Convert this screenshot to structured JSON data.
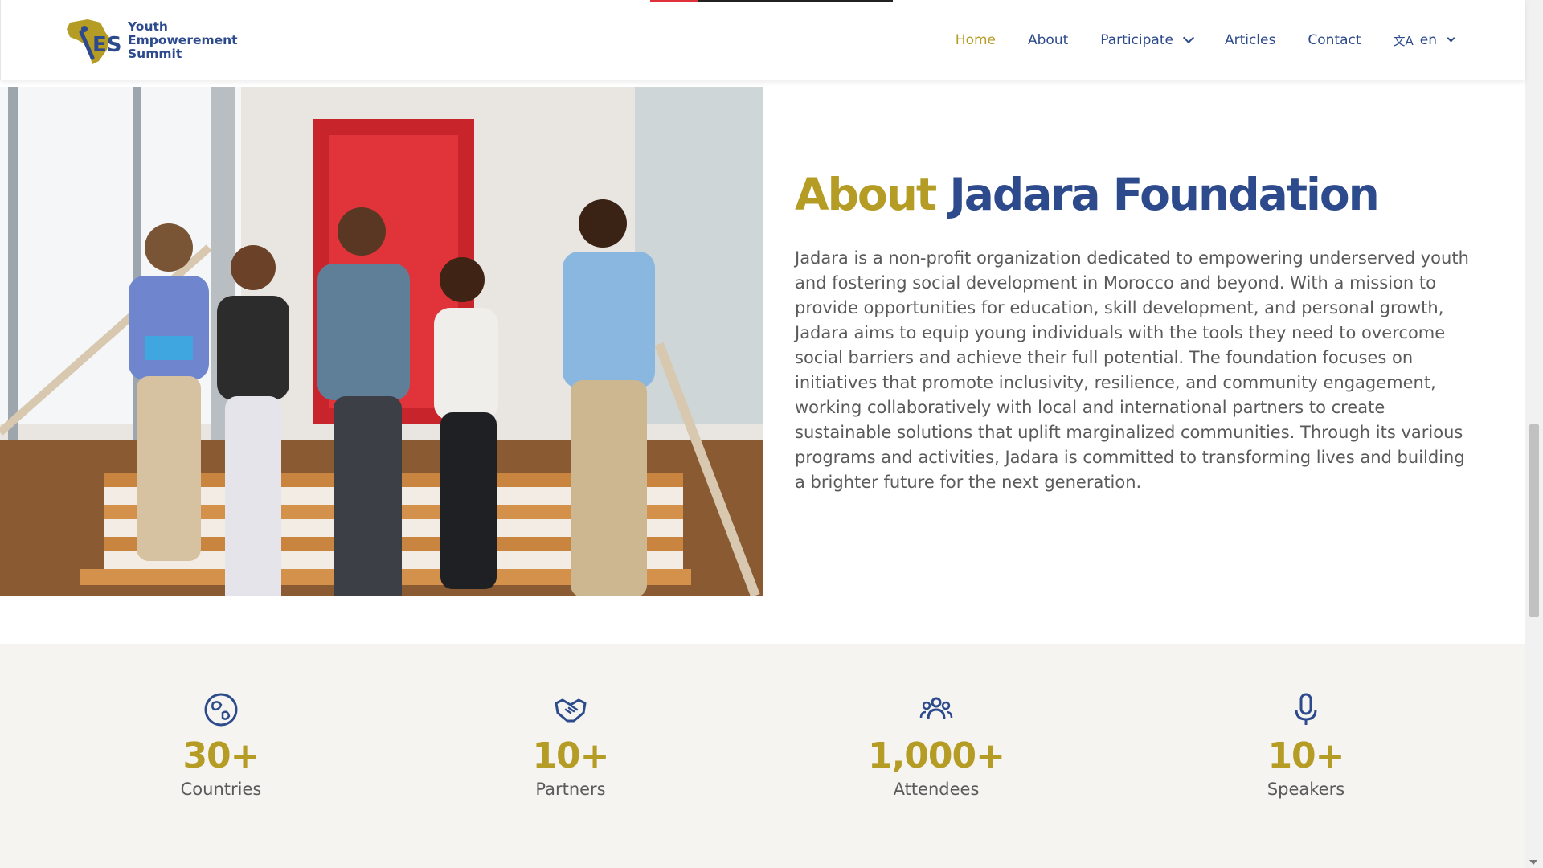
{
  "header": {
    "logo_lines": [
      "Youth",
      "Empowerement",
      "Summit"
    ],
    "logo_mark": "YES",
    "nav": [
      {
        "label": "Home",
        "active": true
      },
      {
        "label": "About"
      },
      {
        "label": "Participate",
        "dropdown": true
      },
      {
        "label": "Articles"
      },
      {
        "label": "Contact"
      }
    ],
    "language": {
      "icon": "translate-icon",
      "value": "en"
    }
  },
  "about": {
    "title_first": "About",
    "title_second": "Jadara Foundation",
    "body": "Jadara is a non-profit organization dedicated to empowering underserved youth and fostering social development in Morocco and beyond. With a mission to provide opportunities for education, skill development, and personal growth, Jadara aims to equip young individuals with the tools they need to overcome social barriers and achieve their full potential. The foundation focuses on initiatives that promote inclusivity, resilience, and community engagement, working collaboratively with local and international partners to create sustainable solutions that uplift marginalized communities. Through its various programs and activities, Jadara is committed to transforming lives and building a brighter future for the next generation."
  },
  "stats": [
    {
      "icon": "globe-icon",
      "value": "30+",
      "label": "Countries"
    },
    {
      "icon": "handshake-icon",
      "value": "10+",
      "label": "Partners"
    },
    {
      "icon": "people-icon",
      "value": "1,000+",
      "label": "Attendees"
    },
    {
      "icon": "microphone-icon",
      "value": "10+",
      "label": "Speakers"
    }
  ],
  "colors": {
    "gold": "#b59c24",
    "blue": "#2c4a8c",
    "stats_bg": "#f5f4f1",
    "body_text": "#5a5a5a"
  }
}
